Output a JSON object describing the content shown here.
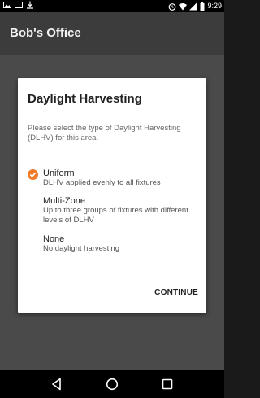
{
  "status_bar": {
    "time": "9:29",
    "left_icons": [
      "image-icon",
      "screen-icon",
      "download-icon"
    ],
    "right_icons": [
      "alarm-icon",
      "wifi-icon",
      "signal-icon",
      "battery-icon"
    ]
  },
  "app_bar": {
    "title": "Bob's Office"
  },
  "dialog": {
    "title": "Daylight Harvesting",
    "message": "Please select the type of Daylight Harvesting (DLHV) for this area.",
    "options": [
      {
        "label": "Uniform",
        "description": "DLHV applied evenly to all fixtures",
        "selected": true
      },
      {
        "label": "Multi-Zone",
        "description": "Up to three groups of fixtures with different levels of DLHV",
        "selected": false
      },
      {
        "label": "None",
        "description": "No daylight harvesting",
        "selected": false
      }
    ],
    "continue_label": "CONTINUE"
  },
  "nav_bar": {
    "buttons": [
      "back-icon",
      "home-icon",
      "recents-icon"
    ]
  },
  "colors": {
    "accent": "#f07c2a",
    "app_bar": "#3c3c3c",
    "scrim": "#4a4a4a"
  }
}
